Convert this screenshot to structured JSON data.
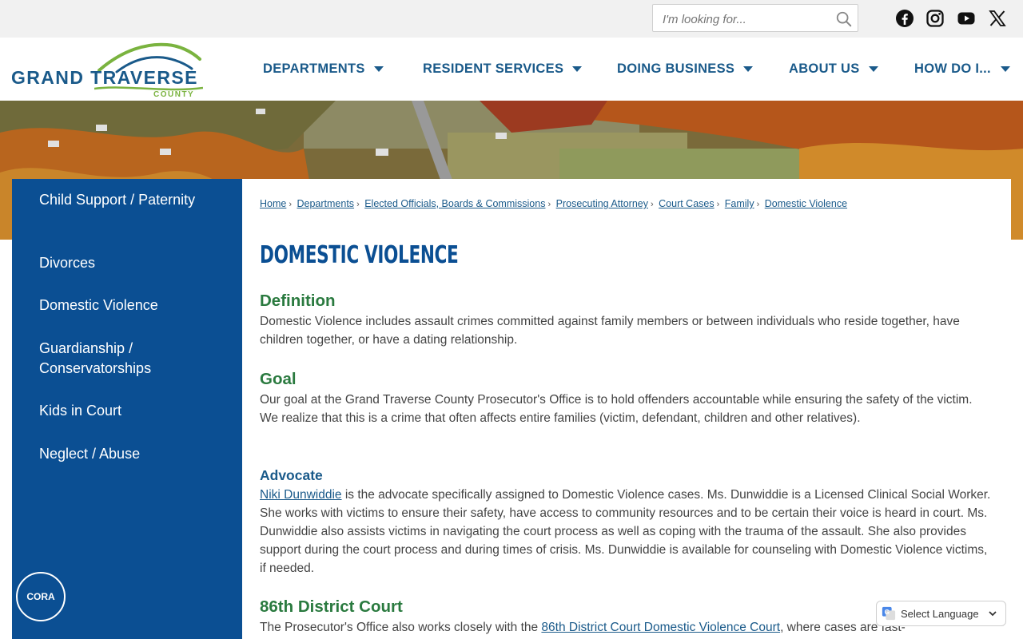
{
  "search": {
    "placeholder": "I'm looking for..."
  },
  "social": [
    "facebook-icon",
    "instagram-icon",
    "youtube-icon",
    "x-icon"
  ],
  "logo": {
    "main_a": "GRAND",
    "main_b": "TRAVERSE",
    "sub": "COUNTY"
  },
  "nav": {
    "items": [
      {
        "label": "DEPARTMENTS"
      },
      {
        "label": "RESIDENT SERVICES"
      },
      {
        "label": "DOING BUSINESS"
      },
      {
        "label": "ABOUT US"
      },
      {
        "label": "HOW DO I..."
      }
    ]
  },
  "sidebar": {
    "items": [
      {
        "label": "Child Support / Paternity"
      },
      {
        "label": "Divorces"
      },
      {
        "label": "Domestic Violence"
      },
      {
        "label": "Guardianship / Conservatorships"
      },
      {
        "label": "Kids in Court"
      },
      {
        "label": "Neglect / Abuse"
      }
    ],
    "cora": "CORA"
  },
  "breadcrumb": [
    "Home",
    "Departments",
    "Elected Officials, Boards & Commissions",
    "Prosecuting Attorney",
    "Court Cases",
    "Family",
    "Domestic Violence"
  ],
  "page": {
    "title": "DOMESTIC VIOLENCE",
    "definition_heading": "Definition",
    "definition_text": "Domestic Violence includes assault crimes committed against family members or between individuals who reside together, have children together, or have a dating relationship.",
    "goal_heading": "Goal",
    "goal_text": "Our goal at the Grand Traverse County Prosecutor's Office is to hold offenders accountable while ensuring the safety of the victim. We realize that this is a crime that often affects entire families (victim, defendant, children and other relatives).",
    "advocate_heading": "Advocate",
    "advocate_link": "Niki Dunwiddie",
    "advocate_text": " is the advocate specifically assigned to Domestic Violence cases. Ms. Dunwiddie is a Licensed Clinical Social Worker. She works with victims to ensure their safety, have access to community resources and to be certain their voice is heard in court. Ms. Dunwiddie also assists victims in navigating the court process as well as coping with the trauma of the assault. She also provides support during the court process and during times of crisis. Ms. Dunwiddie is available for counseling with Domestic Violence victims, if needed.",
    "court_heading": "86th District Court",
    "court_text_a": "The Prosecutor's Office also works closely with the ",
    "court_link": "86th District Court Domestic Violence Court",
    "court_text_b": ", where cases are fast-"
  },
  "translate": {
    "label": "Select Language"
  }
}
